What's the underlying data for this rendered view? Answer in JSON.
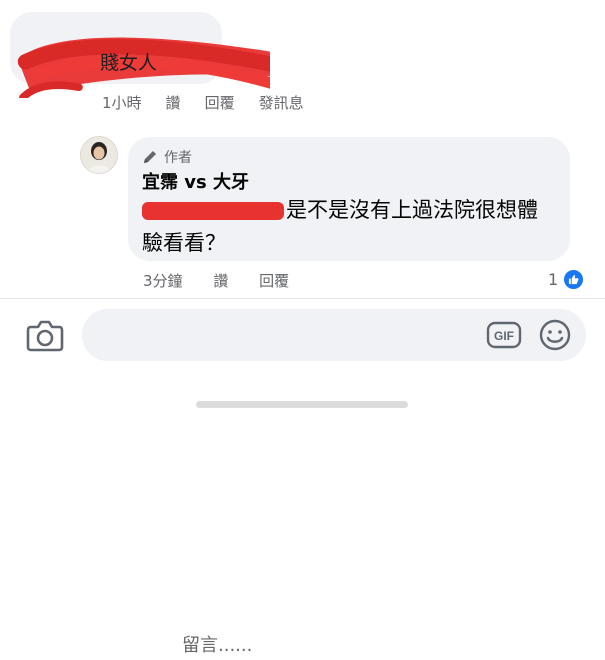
{
  "comment": {
    "text": "賤女人",
    "time": "1小時",
    "actions": {
      "like": "讚",
      "reply": "回覆",
      "message": "發訊息"
    }
  },
  "reply": {
    "author_badge": "作者",
    "author_name": "宜霈 vs 大牙",
    "text": "是不是沒有上過法院很想體驗看看？",
    "time": "3分鐘",
    "actions": {
      "like": "讚",
      "reply": "回覆"
    },
    "reaction_count": "1",
    "reaction_icon": "thumbs-up-icon"
  },
  "composer": {
    "placeholder": "留言......",
    "camera_icon": "camera-icon",
    "gif_label": "GIF",
    "emoji_icon": "smiley-icon"
  },
  "colors": {
    "bubble": "#f0f2f5",
    "meta_text": "#65676b",
    "like_blue": "#1877f2",
    "redaction": "#e8322f"
  }
}
